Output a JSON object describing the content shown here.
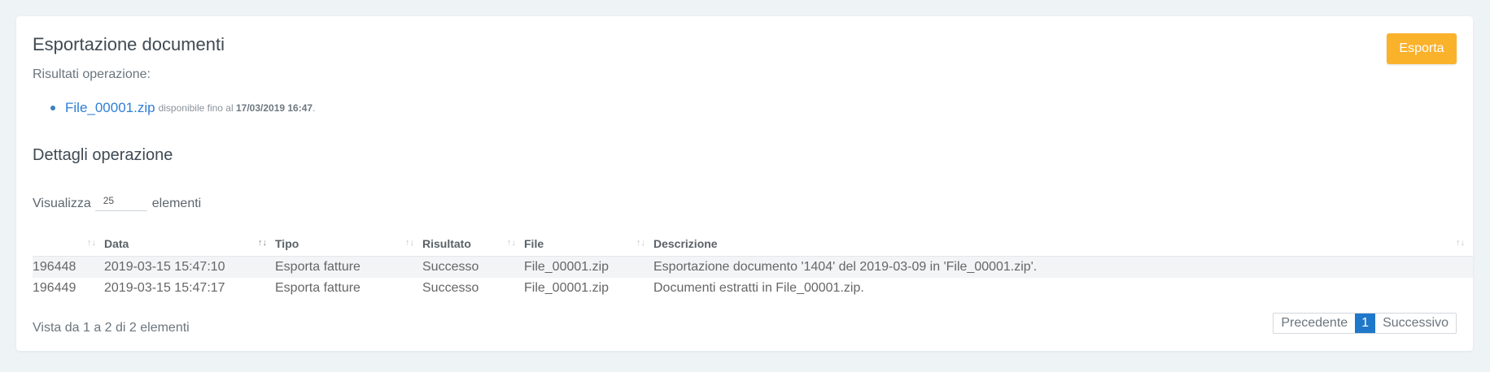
{
  "header": {
    "title": "Esportazione documenti",
    "export_label": "Esporta"
  },
  "results": {
    "label": "Risultati operazione:",
    "items": [
      {
        "file": "File_00001.zip",
        "text": "disponibile fino al",
        "date": "17/03/2019 16:47",
        "suffix": "."
      }
    ]
  },
  "details": {
    "title": "Dettagli operazione",
    "show_prefix": "Visualizza",
    "page_size": "25",
    "show_suffix": "elementi"
  },
  "table": {
    "columns": [
      "",
      "Data",
      "Tipo",
      "Risultato",
      "File",
      "Descrizione"
    ],
    "rows": [
      [
        "196448",
        "2019-03-15 15:47:10",
        "Esporta fatture",
        "Successo",
        "File_00001.zip",
        "Esportazione documento '1404' del 2019-03-09 in 'File_00001.zip'."
      ],
      [
        "196449",
        "2019-03-15 15:47:17",
        "Esporta fatture",
        "Successo",
        "File_00001.zip",
        "Documenti estratti in File_00001.zip."
      ]
    ]
  },
  "footer": {
    "info": "Vista da 1 a 2 di 2 elementi",
    "prev": "Precedente",
    "current": "1",
    "next": "Successivo"
  }
}
